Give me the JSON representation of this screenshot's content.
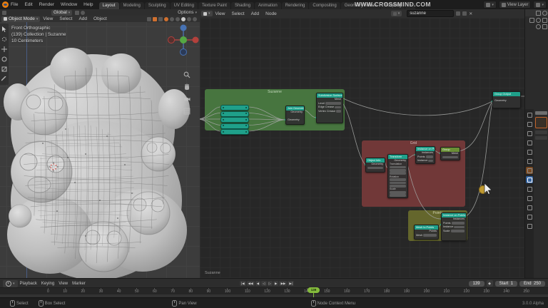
{
  "topbar": {
    "menus": [
      "File",
      "Edit",
      "Render",
      "Window",
      "Help"
    ],
    "tabs": [
      {
        "label": "Layout",
        "active": true
      },
      {
        "label": "Modeling"
      },
      {
        "label": "Sculpting"
      },
      {
        "label": "UV Editing"
      },
      {
        "label": "Texture Paint"
      },
      {
        "label": "Shading"
      },
      {
        "label": "Animation"
      },
      {
        "label": "Rendering"
      },
      {
        "label": "Compositing"
      },
      {
        "label": "Geometry Nodes"
      },
      {
        "label": "Scripting"
      },
      {
        "label": "+"
      }
    ],
    "watermark": "WWW.CROSSMIND.COM",
    "view_layer": "View Layer"
  },
  "viewport": {
    "tool_settings": {
      "orientation": "Global",
      "options_label": "Options"
    },
    "header": {
      "mode": "Object Mode",
      "menus": [
        "View",
        "Select",
        "Add",
        "Object"
      ]
    },
    "overlay": {
      "line1": "Front Orthographic",
      "line2": "(139) Collection | Suzanne",
      "line3": "10 Centimeters"
    }
  },
  "node_editor": {
    "header": {
      "menus": [
        "View",
        "Select",
        "Add",
        "Node"
      ],
      "datablock": "suzanne"
    },
    "breadcrumb": "Suzanne",
    "frames": {
      "green": {
        "label": "Suzanne",
        "color": "#47753f"
      },
      "red": {
        "label": "Grid",
        "color": "#713838"
      },
      "olive": {
        "label": "Points",
        "color": "#64662c"
      }
    },
    "nodes": {
      "join": {
        "title": "Join Geometry",
        "out": "Geometry",
        "in": "Geometry"
      },
      "subdiv": {
        "title": "Subdivision Surface",
        "out": "Mesh",
        "rows": [
          "Level",
          "Edge Crease",
          "Vertex Crease"
        ]
      },
      "objinfo": {
        "title": "Object Info",
        "out": "Geometry"
      },
      "transform": {
        "title": "Transform",
        "out": "Geometry",
        "rows": [
          "Translation",
          "Rotation",
          "Scale"
        ]
      },
      "instance1": {
        "title": "Instance on Points",
        "out": "Instances",
        "rows": [
          "Points",
          "Instance"
        ]
      },
      "group": {
        "title": "Group",
        "out": "Mesh"
      },
      "meshpts": {
        "title": "Mesh to Points",
        "out": "Points",
        "rows": [
          "Mesh",
          "Radius"
        ]
      },
      "instance2": {
        "title": "Instance on Points",
        "out": "Instances",
        "rows": [
          "Points",
          "Instance",
          "Scale"
        ]
      },
      "output": {
        "title": "Group Output",
        "in": "Geometry"
      }
    },
    "colors": {
      "node_header": "#1fa08a",
      "wire": "#a3a5a3"
    }
  },
  "timeline": {
    "menus": [
      "Playback",
      "Keying",
      "View",
      "Marker"
    ],
    "playback_buttons": [
      "|◀",
      "◀◀",
      "◀",
      "◁",
      "▷",
      "▶",
      "▶▶",
      "▶|"
    ],
    "ticks": [
      "0",
      "10",
      "20",
      "30",
      "40",
      "50",
      "60",
      "70",
      "80",
      "90",
      "100",
      "110",
      "120",
      "130",
      "140",
      "150",
      "160",
      "170",
      "180",
      "190",
      "200",
      "210",
      "220",
      "230",
      "240",
      "250"
    ],
    "current_frame": "139",
    "start_label": "Start",
    "start_value": "1",
    "end_label": "End",
    "end_value": "250"
  },
  "statusbar": {
    "items": [
      "Select",
      "Box Select",
      "Pan View",
      "Node Context Menu"
    ],
    "version": "3.0.0 Alpha"
  }
}
